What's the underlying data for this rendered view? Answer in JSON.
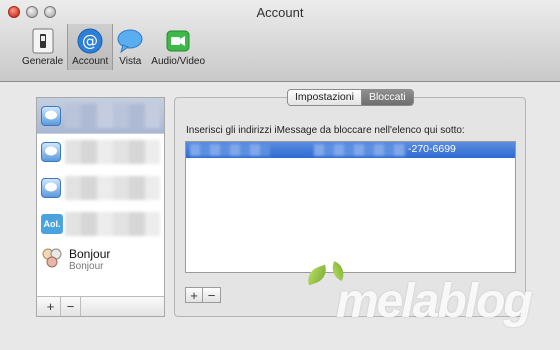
{
  "window": {
    "title": "Account"
  },
  "toolbar": {
    "items": [
      {
        "label": "Generale",
        "icon": "switch-icon"
      },
      {
        "label": "Account",
        "icon": "at-sign-icon",
        "selected": true
      },
      {
        "label": "Vista",
        "icon": "speech-bubble-icon"
      },
      {
        "label": "Audio/Video",
        "icon": "video-camera-icon"
      }
    ]
  },
  "sidebar": {
    "accounts": [
      {
        "icon": "imessage-icon",
        "selected": true
      },
      {
        "icon": "imessage-icon"
      },
      {
        "icon": "imessage-icon"
      },
      {
        "icon": "aol-icon",
        "icon_text": "Aol."
      },
      {
        "icon": "bonjour-icon",
        "name": "Bonjour",
        "subtitle": "Bonjour"
      }
    ],
    "add_label": "+",
    "remove_label": "−"
  },
  "tabs": [
    {
      "label": "Impostazioni",
      "active": false
    },
    {
      "label": "Bloccati",
      "active": true
    }
  ],
  "blocked": {
    "instructions": "Inserisci gli indirizzi iMessage da bloccare nell'elenco qui sotto:",
    "entries": [
      {
        "visible_text": "-270-6699"
      }
    ],
    "add_label": "+",
    "remove_label": "−"
  },
  "watermark": {
    "text": "melablog"
  },
  "colors": {
    "selection": "#3a74d6",
    "accent": "#2f6bd2"
  }
}
